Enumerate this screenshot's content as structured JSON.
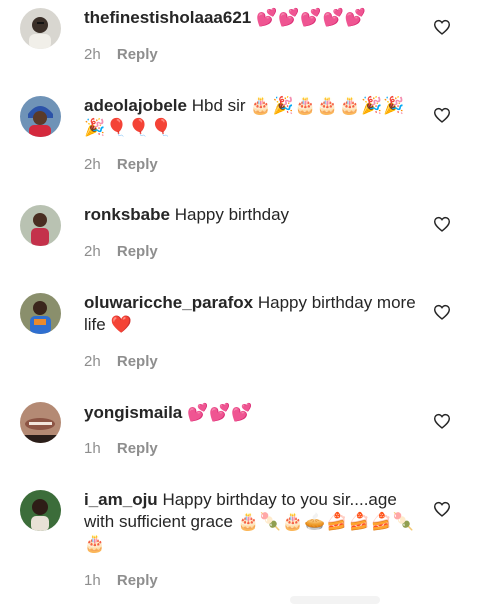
{
  "comments": [
    {
      "username": "thefinestisholaaa621",
      "text": "",
      "emoji": "💕💕💕💕💕",
      "time": "2h",
      "reply": "Reply"
    },
    {
      "username": "adeolajobele",
      "text": "Hbd sir",
      "emoji": "🎂🎉🎂🎂🎂🎉🎉🎉🎈🎈🎈",
      "time": "2h",
      "reply": "Reply"
    },
    {
      "username": "ronksbabe",
      "text": "Happy birthday",
      "emoji": "",
      "time": "2h",
      "reply": "Reply"
    },
    {
      "username": "oluwaricche_parafox",
      "text": "Happy birthday more life",
      "emoji": "❤️",
      "time": "2h",
      "reply": "Reply"
    },
    {
      "username": "yongismaila",
      "text": "",
      "emoji": "💕💕💕",
      "time": "1h",
      "reply": "Reply"
    },
    {
      "username": "i_am_oju",
      "text": "Happy birthday to you sir....age with sufficient grace",
      "emoji": "🎂🍡🎂🥧🍰🍰🍰🍡🎂",
      "time": "1h",
      "reply": "Reply"
    }
  ],
  "colors": {
    "text": "#262626",
    "muted": "#8e8e8e",
    "heart_outline": "#262626",
    "heart_filled": "#ed4956"
  }
}
